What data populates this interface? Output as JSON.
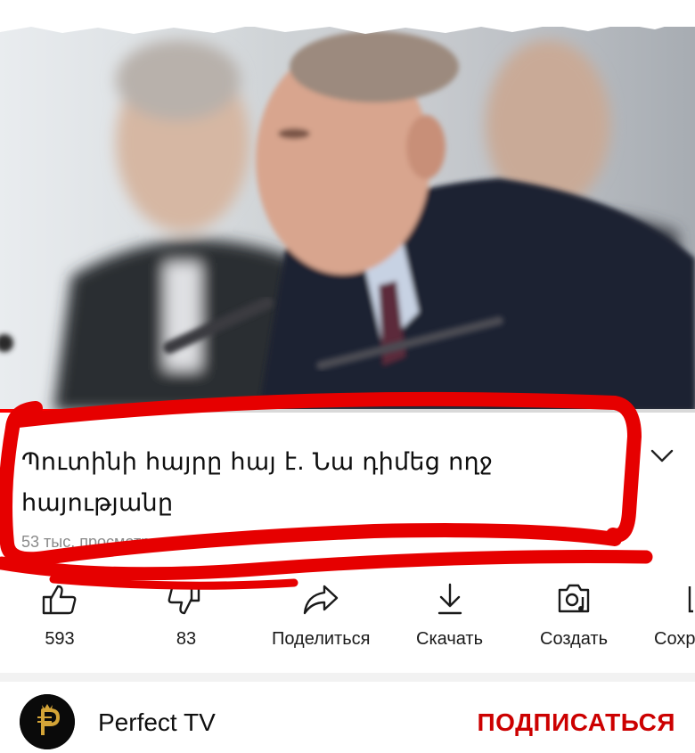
{
  "video": {
    "title": "Պուտինի հայրը հայ է. Նա դիմեց ողջ հայությանը",
    "views": "53 тыс. просмотров",
    "progress_fraction": 0.18
  },
  "actions": [
    {
      "icon": "thumbs-up-icon",
      "label": "593"
    },
    {
      "icon": "thumbs-down-icon",
      "label": "83"
    },
    {
      "icon": "share-icon",
      "label": "Поделиться"
    },
    {
      "icon": "download-icon",
      "label": "Скачать"
    },
    {
      "icon": "create-icon",
      "label": "Создать"
    },
    {
      "icon": "save-icon",
      "label": "Сохр"
    }
  ],
  "channel": {
    "name": "Perfect TV",
    "subscribe_label": "ПОДПИСАТЬСЯ"
  },
  "colors": {
    "annotation": "#e60000",
    "subscribe": "#cc0000",
    "progress": "#ff0000"
  }
}
